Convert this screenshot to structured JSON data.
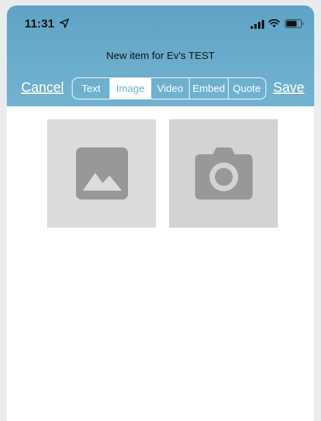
{
  "status_bar": {
    "time": "11:31",
    "location_icon": "location-arrow-icon",
    "signal_icon": "cellular-signal-icon",
    "wifi_icon": "wifi-icon",
    "battery_icon": "battery-icon"
  },
  "header": {
    "title": "New item for Ev's TEST",
    "cancel_label": "Cancel",
    "save_label": "Save"
  },
  "tabs": [
    {
      "label": "Text",
      "active": false
    },
    {
      "label": "Image",
      "active": true
    },
    {
      "label": "Video",
      "active": false
    },
    {
      "label": "Embed",
      "active": false
    },
    {
      "label": "Quote",
      "active": false
    }
  ],
  "media_options": [
    {
      "icon": "image-gallery-icon"
    },
    {
      "icon": "camera-icon"
    }
  ],
  "colors": {
    "header_top": "#5fa3c5",
    "header_bottom": "#72b3d0",
    "active_tab_text": "#6aaed0",
    "tile_icon": "#989898"
  }
}
